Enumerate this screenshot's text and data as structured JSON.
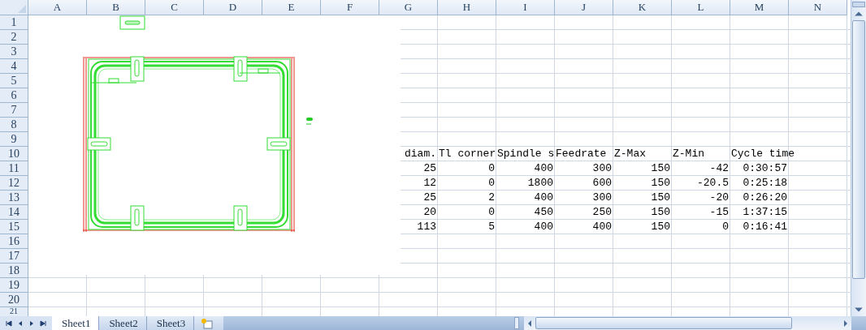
{
  "column_headers": [
    "A",
    "B",
    "C",
    "D",
    "E",
    "F",
    "G",
    "H",
    "I",
    "J",
    "K",
    "L",
    "M",
    "N"
  ],
  "row_headers": [
    "1",
    "2",
    "3",
    "4",
    "5",
    "6",
    "7",
    "8",
    "9",
    "10",
    "11",
    "12",
    "13",
    "14",
    "15",
    "16",
    "17",
    "18",
    "19",
    "20",
    "21"
  ],
  "table": {
    "columns": [
      "diam.",
      "Tl corner",
      "Spindle s",
      "Feedrate",
      "Z-Max",
      "Z-Min",
      "Cycle time"
    ],
    "rows": [
      [
        "25",
        "0",
        "400",
        "300",
        "150",
        "-42",
        "0:30:57"
      ],
      [
        "12",
        "0",
        "1800",
        "600",
        "150",
        "-20.5",
        "0:25:18"
      ],
      [
        "25",
        "2",
        "400",
        "300",
        "150",
        "-20",
        "0:26:20"
      ],
      [
        "20",
        "0",
        "450",
        "250",
        "150",
        "-15",
        "1:37:15"
      ],
      [
        "113",
        "5",
        "400",
        "400",
        "150",
        "0",
        "0:16:41"
      ]
    ]
  },
  "sheet_tabs": [
    {
      "label": "Sheet1",
      "selected": true
    },
    {
      "label": "Sheet2",
      "selected": false
    },
    {
      "label": "Sheet3",
      "selected": false
    }
  ]
}
